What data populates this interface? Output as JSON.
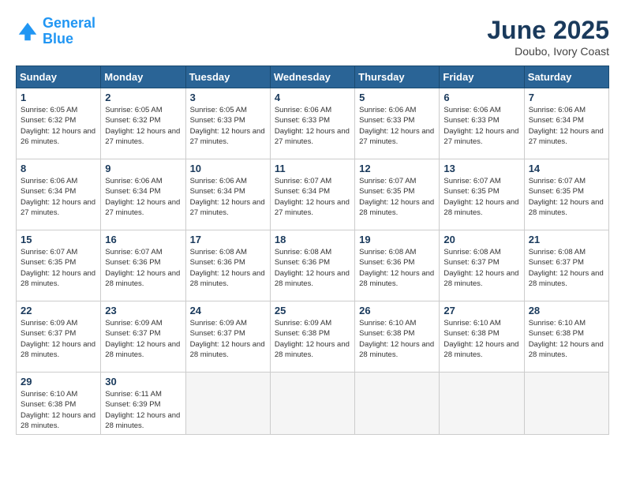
{
  "header": {
    "logo_line1": "General",
    "logo_line2": "Blue",
    "month_title": "June 2025",
    "location": "Doubo, Ivory Coast"
  },
  "weekdays": [
    "Sunday",
    "Monday",
    "Tuesday",
    "Wednesday",
    "Thursday",
    "Friday",
    "Saturday"
  ],
  "weeks": [
    [
      {
        "day": "1",
        "sunrise": "6:05 AM",
        "sunset": "6:32 PM",
        "daylight": "12 hours and 26 minutes."
      },
      {
        "day": "2",
        "sunrise": "6:05 AM",
        "sunset": "6:32 PM",
        "daylight": "12 hours and 27 minutes."
      },
      {
        "day": "3",
        "sunrise": "6:05 AM",
        "sunset": "6:33 PM",
        "daylight": "12 hours and 27 minutes."
      },
      {
        "day": "4",
        "sunrise": "6:06 AM",
        "sunset": "6:33 PM",
        "daylight": "12 hours and 27 minutes."
      },
      {
        "day": "5",
        "sunrise": "6:06 AM",
        "sunset": "6:33 PM",
        "daylight": "12 hours and 27 minutes."
      },
      {
        "day": "6",
        "sunrise": "6:06 AM",
        "sunset": "6:33 PM",
        "daylight": "12 hours and 27 minutes."
      },
      {
        "day": "7",
        "sunrise": "6:06 AM",
        "sunset": "6:34 PM",
        "daylight": "12 hours and 27 minutes."
      }
    ],
    [
      {
        "day": "8",
        "sunrise": "6:06 AM",
        "sunset": "6:34 PM",
        "daylight": "12 hours and 27 minutes."
      },
      {
        "day": "9",
        "sunrise": "6:06 AM",
        "sunset": "6:34 PM",
        "daylight": "12 hours and 27 minutes."
      },
      {
        "day": "10",
        "sunrise": "6:06 AM",
        "sunset": "6:34 PM",
        "daylight": "12 hours and 27 minutes."
      },
      {
        "day": "11",
        "sunrise": "6:07 AM",
        "sunset": "6:34 PM",
        "daylight": "12 hours and 27 minutes."
      },
      {
        "day": "12",
        "sunrise": "6:07 AM",
        "sunset": "6:35 PM",
        "daylight": "12 hours and 28 minutes."
      },
      {
        "day": "13",
        "sunrise": "6:07 AM",
        "sunset": "6:35 PM",
        "daylight": "12 hours and 28 minutes."
      },
      {
        "day": "14",
        "sunrise": "6:07 AM",
        "sunset": "6:35 PM",
        "daylight": "12 hours and 28 minutes."
      }
    ],
    [
      {
        "day": "15",
        "sunrise": "6:07 AM",
        "sunset": "6:35 PM",
        "daylight": "12 hours and 28 minutes."
      },
      {
        "day": "16",
        "sunrise": "6:07 AM",
        "sunset": "6:36 PM",
        "daylight": "12 hours and 28 minutes."
      },
      {
        "day": "17",
        "sunrise": "6:08 AM",
        "sunset": "6:36 PM",
        "daylight": "12 hours and 28 minutes."
      },
      {
        "day": "18",
        "sunrise": "6:08 AM",
        "sunset": "6:36 PM",
        "daylight": "12 hours and 28 minutes."
      },
      {
        "day": "19",
        "sunrise": "6:08 AM",
        "sunset": "6:36 PM",
        "daylight": "12 hours and 28 minutes."
      },
      {
        "day": "20",
        "sunrise": "6:08 AM",
        "sunset": "6:37 PM",
        "daylight": "12 hours and 28 minutes."
      },
      {
        "day": "21",
        "sunrise": "6:08 AM",
        "sunset": "6:37 PM",
        "daylight": "12 hours and 28 minutes."
      }
    ],
    [
      {
        "day": "22",
        "sunrise": "6:09 AM",
        "sunset": "6:37 PM",
        "daylight": "12 hours and 28 minutes."
      },
      {
        "day": "23",
        "sunrise": "6:09 AM",
        "sunset": "6:37 PM",
        "daylight": "12 hours and 28 minutes."
      },
      {
        "day": "24",
        "sunrise": "6:09 AM",
        "sunset": "6:37 PM",
        "daylight": "12 hours and 28 minutes."
      },
      {
        "day": "25",
        "sunrise": "6:09 AM",
        "sunset": "6:38 PM",
        "daylight": "12 hours and 28 minutes."
      },
      {
        "day": "26",
        "sunrise": "6:10 AM",
        "sunset": "6:38 PM",
        "daylight": "12 hours and 28 minutes."
      },
      {
        "day": "27",
        "sunrise": "6:10 AM",
        "sunset": "6:38 PM",
        "daylight": "12 hours and 28 minutes."
      },
      {
        "day": "28",
        "sunrise": "6:10 AM",
        "sunset": "6:38 PM",
        "daylight": "12 hours and 28 minutes."
      }
    ],
    [
      {
        "day": "29",
        "sunrise": "6:10 AM",
        "sunset": "6:38 PM",
        "daylight": "12 hours and 28 minutes."
      },
      {
        "day": "30",
        "sunrise": "6:11 AM",
        "sunset": "6:39 PM",
        "daylight": "12 hours and 28 minutes."
      },
      null,
      null,
      null,
      null,
      null
    ]
  ]
}
